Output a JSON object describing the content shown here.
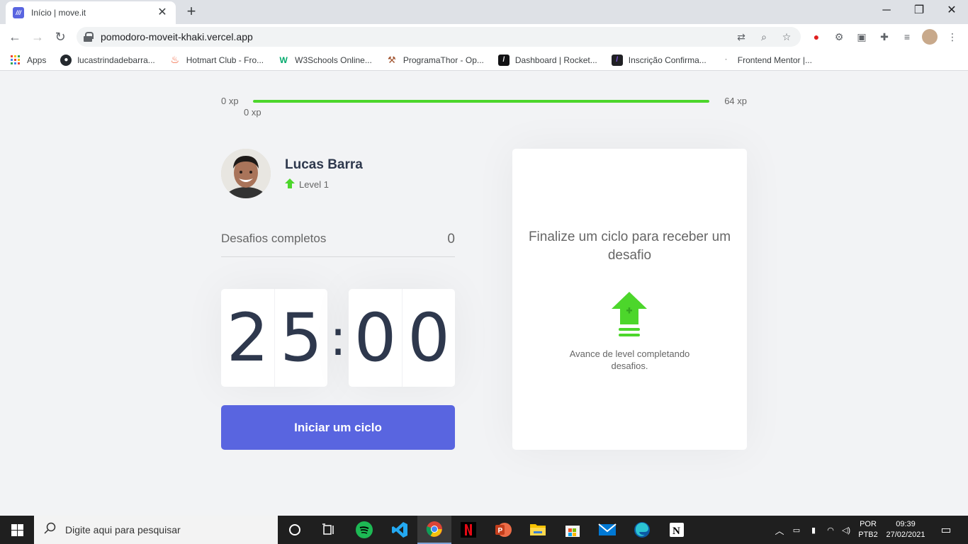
{
  "browser": {
    "tab_title": "Início | move.it",
    "url": "pomodoro-moveit-khaki.vercel.app",
    "bookmarks": [
      {
        "label": "Apps",
        "icon": "apps-grid-icon"
      },
      {
        "label": "lucastrindadebarra...",
        "icon": "github-icon"
      },
      {
        "label": "Hotmart Club - Fro...",
        "icon": "hotmart-icon"
      },
      {
        "label": "W3Schools Online...",
        "icon": "w3schools-icon"
      },
      {
        "label": "ProgramaThor - Op...",
        "icon": "hammer-icon"
      },
      {
        "label": "Dashboard | Rocket...",
        "icon": "rocketseat-icon"
      },
      {
        "label": "Inscrição Confirma...",
        "icon": "rocketseat-icon"
      },
      {
        "label": "Frontend Mentor |...",
        "icon": "frontend-mentor-icon"
      }
    ]
  },
  "app": {
    "xp": {
      "min": "0 xp",
      "max": "64 xp",
      "current": "0 xp",
      "progress": 1.0
    },
    "profile": {
      "name": "Lucas Barra",
      "level": "Level 1"
    },
    "completed": {
      "label": "Desafios completos",
      "value": "0"
    },
    "countdown": {
      "minutes": [
        "2",
        "5"
      ],
      "seconds": [
        "0",
        "0"
      ],
      "separator": ":"
    },
    "start_button": "Iniciar um ciclo",
    "challenge": {
      "title": "Finalize um ciclo para receber um desafio",
      "text": "Avance de level completando desafios."
    },
    "colors": {
      "accent": "#5965e0",
      "green": "#4cd62b",
      "title": "#2e384d",
      "text": "#666666"
    }
  },
  "taskbar": {
    "search_placeholder": "Digite aqui para pesquisar",
    "lang_top": "POR",
    "lang_bottom": "PTB2",
    "time": "09:39",
    "date": "27/02/2021"
  }
}
